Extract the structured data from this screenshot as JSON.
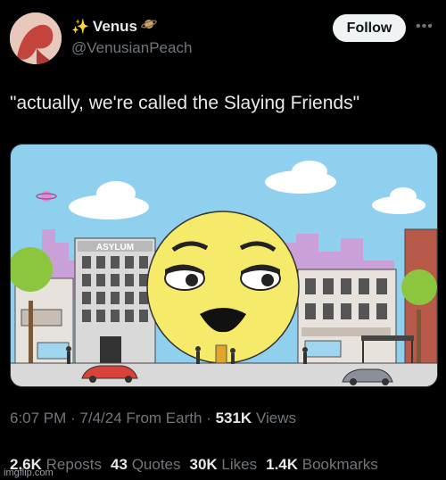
{
  "author": {
    "display_name": "Venus",
    "name_prefix_emoji": "✨",
    "name_suffix_emoji_icon": "saturn-planet-icon",
    "handle": "@VenusianPeach"
  },
  "follow_label": "Follow",
  "more_icon": "more-horizontal-icon",
  "tweet_text": "\"actually, we're called the Slaying Friends\"",
  "media": {
    "asylum_sign": "ASYLUM",
    "colors": {
      "sky": "#8fd0ee",
      "sun_face": "#f5ea6a",
      "street": "#d9d9d9"
    }
  },
  "meta": {
    "time": "6:07 PM",
    "date": "7/4/24",
    "source": "From Earth",
    "views_count": "531K",
    "views_label": "Views"
  },
  "stats": {
    "reposts_count": "2.6K",
    "reposts_label": "Reposts",
    "quotes_count": "43",
    "quotes_label": "Quotes",
    "likes_count": "30K",
    "likes_label": "Likes",
    "bookmarks_count": "1.4K",
    "bookmarks_label": "Bookmarks"
  },
  "watermark": "imgflip.com"
}
